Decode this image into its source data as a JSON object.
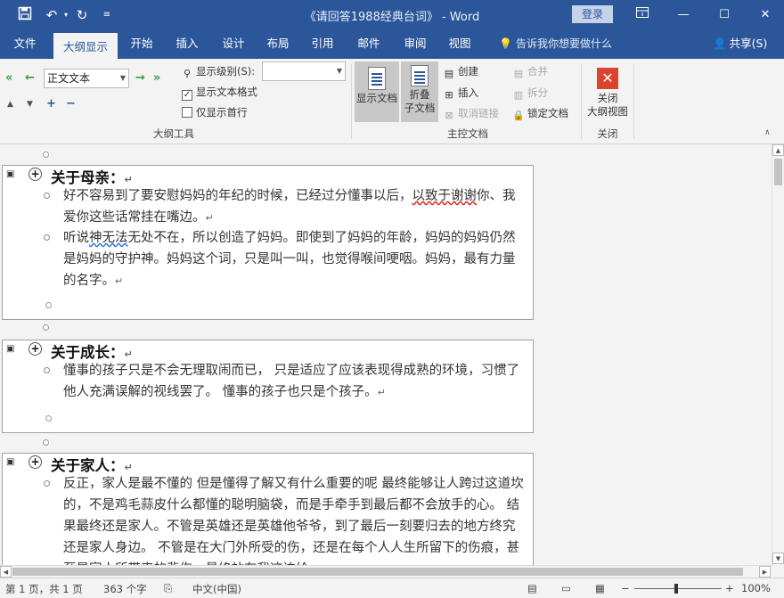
{
  "titlebar": {
    "document_title": "《请回答1988经典台词》 - Word",
    "login_label": "登录",
    "quick_access": [
      "save-icon",
      "undo-icon",
      "redo-icon",
      "customize-icon"
    ],
    "window_controls": [
      "ribbon-display-icon",
      "minimize-icon",
      "maximize-icon",
      "close-icon"
    ]
  },
  "tabs": [
    {
      "label": "文件"
    },
    {
      "label": "大纲显示"
    },
    {
      "label": "开始"
    },
    {
      "label": "插入"
    },
    {
      "label": "设计"
    },
    {
      "label": "布局"
    },
    {
      "label": "引用"
    },
    {
      "label": "邮件"
    },
    {
      "label": "审阅"
    },
    {
      "label": "视图"
    }
  ],
  "tellme": "告诉我你想要做什么",
  "share": "共享(S)",
  "ribbon": {
    "outline_tools": {
      "label": "大纲工具",
      "style_value": "正文文本",
      "show_level_label": "显示级别(S):",
      "show_level_value": "",
      "show_text_format_label": "显示文本格式",
      "show_text_format_checked": true,
      "show_first_line_label": "仅显示首行",
      "show_first_line_checked": false
    },
    "master_document": {
      "label": "主控文档",
      "show_document": "显示文档",
      "collapse_line1": "折叠",
      "collapse_line2": "子文档",
      "create": "创建",
      "insert": "插入",
      "unlink": "取消链接",
      "merge": "合并",
      "split": "拆分",
      "lock": "锁定文档"
    },
    "close_group": {
      "label": "关闭",
      "close_line1": "关闭",
      "close_line2": "大纲视图"
    }
  },
  "document": {
    "sections": [
      {
        "heading": "关于母亲：",
        "paragraphs": [
          {
            "pre": "好不容易到了要安慰妈妈的年纪的时候，已经过分懂事以后，",
            "squiggle": "以致于谢谢",
            "post": "你、我爱你这些话常挂在嘴边。"
          },
          {
            "pre": "听说",
            "squiggle": "神无法",
            "post": "无处不在，所以创造了妈妈。即使到了妈妈的年龄，妈妈的妈妈仍然是妈妈的守护神。妈妈这个词，只是叫一叫，也觉得喉间哽咽。妈妈，最有力量的名字。"
          }
        ]
      },
      {
        "heading": "关于成长：",
        "paragraphs": [
          {
            "pre": "懂事的孩子只是不会无理取闹而已，  只是适应了应该表现得成熟的环境，习惯了他人充满误解的视线罢了。  懂事的孩子也只是个孩子。",
            "squiggle": "",
            "post": ""
          }
        ]
      },
      {
        "heading": "关于家人：",
        "paragraphs": [
          {
            "pre": "反正，家人是最不懂的  但是懂得了解又有什么重要的呢  最终能够让人跨过这道坎的，不是鸡毛蒜皮什么都懂的聪明脑袋，而是手牵手到最后都不会放手的心。  结果最终还是家人。不管是英雄还是英雄他爷爷，到了最后一刻要归去的地方终究还是家人身边。  不管是在大门外所受的伤，还是在每个人人生所留下的伤痕，甚至是家人所带来的悲伤，最终站在我这边给",
            "squiggle": "",
            "post": ""
          }
        ]
      }
    ],
    "paragraph_mark": "↵"
  },
  "statusbar": {
    "page": "第 1 页，共 1 页",
    "words": "363 个字",
    "language": "中文(中国)",
    "zoom_percent": "100%",
    "zoom_value": 100
  }
}
